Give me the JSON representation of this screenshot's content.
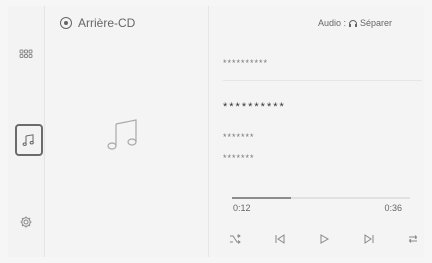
{
  "source": {
    "label": "Arrière-CD",
    "icon": "disc-icon"
  },
  "audio": {
    "prefix": "Audio :",
    "mode": "Séparer",
    "icon": "headphones-icon"
  },
  "track": {
    "album_top": "**********",
    "title": "**********",
    "artist": "*******",
    "album": "*******",
    "progress_fraction": 0.33,
    "time_elapsed": "0:12",
    "time_total": "0:36"
  },
  "sidebar": {
    "items": [
      {
        "name": "apps-grid",
        "icon": "grid-icon"
      },
      {
        "name": "media",
        "icon": "music-note-icon"
      },
      {
        "name": "settings",
        "icon": "gear-icon"
      }
    ]
  },
  "controls": [
    {
      "name": "shuffle",
      "icon": "shuffle-icon"
    },
    {
      "name": "previous",
      "icon": "previous-track-icon"
    },
    {
      "name": "play",
      "icon": "play-icon"
    },
    {
      "name": "next",
      "icon": "next-track-icon"
    },
    {
      "name": "repeat",
      "icon": "repeat-icon"
    }
  ],
  "colors": {
    "background": "#f6f6f6",
    "text": "#555555",
    "accent": "#6b6b6b"
  }
}
